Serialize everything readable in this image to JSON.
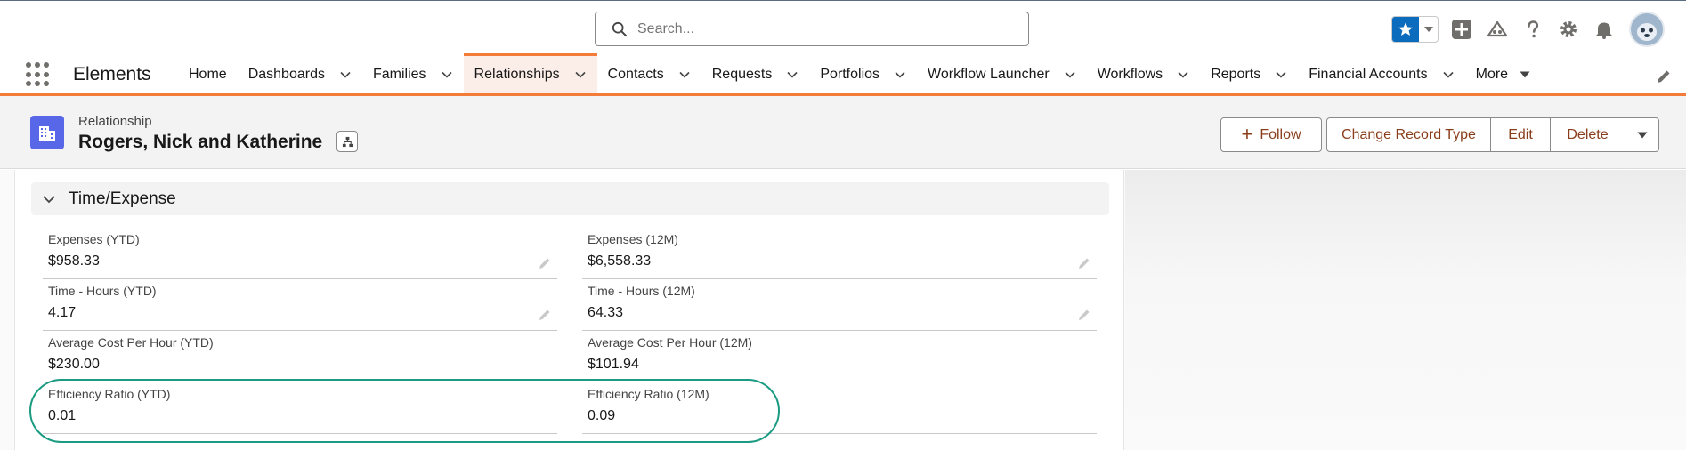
{
  "search": {
    "placeholder": "Search..."
  },
  "app": {
    "name": "Elements"
  },
  "nav": {
    "items": [
      {
        "label": "Home",
        "has_menu": false
      },
      {
        "label": "Dashboards",
        "has_menu": true
      },
      {
        "label": "Families",
        "has_menu": true
      },
      {
        "label": "Relationships",
        "has_menu": true,
        "active": true
      },
      {
        "label": "Contacts",
        "has_menu": true
      },
      {
        "label": "Requests",
        "has_menu": true
      },
      {
        "label": "Portfolios",
        "has_menu": true
      },
      {
        "label": "Workflow Launcher",
        "has_menu": true
      },
      {
        "label": "Workflows",
        "has_menu": true
      },
      {
        "label": "Reports",
        "has_menu": true
      },
      {
        "label": "Financial Accounts",
        "has_menu": true
      },
      {
        "label": "More",
        "has_menu": true
      }
    ]
  },
  "record": {
    "type": "Relationship",
    "name": "Rogers, Nick and Katherine",
    "icon": "building-icon"
  },
  "actions": {
    "follow": "Follow",
    "change_record_type": "Change Record Type",
    "edit": "Edit",
    "delete": "Delete"
  },
  "section": {
    "title": "Time/Expense",
    "fields": [
      {
        "label": "Expenses (YTD)",
        "value": "$958.33",
        "editable": true
      },
      {
        "label": "Expenses (12M)",
        "value": "$6,558.33",
        "editable": true
      },
      {
        "label": "Time - Hours (YTD)",
        "value": "4.17",
        "editable": true
      },
      {
        "label": "Time - Hours (12M)",
        "value": "64.33",
        "editable": true
      },
      {
        "label": "Average Cost Per Hour (YTD)",
        "value": "$230.00",
        "editable": false
      },
      {
        "label": "Average Cost Per Hour (12M)",
        "value": "$101.94",
        "editable": false
      },
      {
        "label": "Efficiency Ratio (YTD)",
        "value": "0.01",
        "editable": false
      },
      {
        "label": "Efficiency Ratio (12M)",
        "value": "0.09",
        "editable": false
      }
    ]
  },
  "colors": {
    "brand_accent": "#f37c3a",
    "button_text": "#8a3d1a",
    "record_icon": "#5867e8",
    "favorite": "#0b6bbd",
    "highlight": "#1a9b82"
  }
}
